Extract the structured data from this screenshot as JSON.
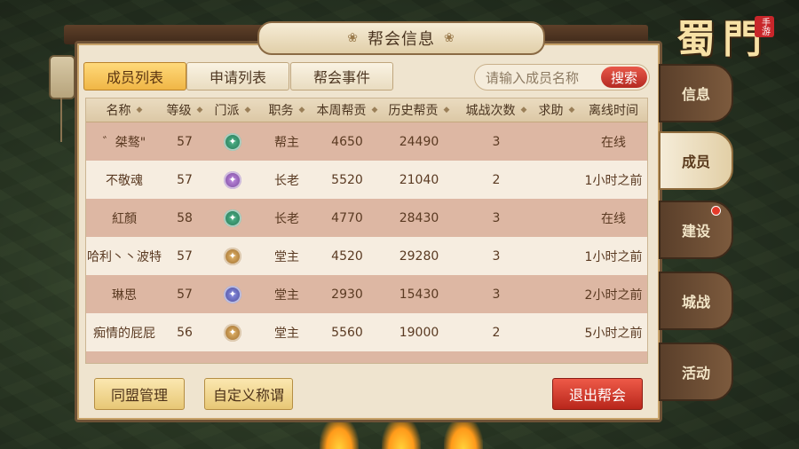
{
  "title": "帮会信息",
  "logo": {
    "text": "蜀門",
    "tag": "手游"
  },
  "tabs": [
    {
      "label": "成员列表",
      "active": true
    },
    {
      "label": "申请列表",
      "active": false
    },
    {
      "label": "帮会事件",
      "active": false
    }
  ],
  "search": {
    "placeholder": "请输入成员名称",
    "button": "搜索"
  },
  "table": {
    "headers": [
      "名称",
      "等级",
      "门派",
      "职务",
      "本周帮贡",
      "历史帮贡",
      "城战次数",
      "求助",
      "离线时间"
    ],
    "rows": [
      {
        "name": "゛桀骜\"",
        "level": "57",
        "sect": "emerald-emblem-icon",
        "role": "帮主",
        "week": "4650",
        "history": "24490",
        "wars": "3",
        "help": "",
        "offline": "在线"
      },
      {
        "name": "不敬魂",
        "level": "57",
        "sect": "violet-emblem-icon",
        "role": "长老",
        "week": "5520",
        "history": "21040",
        "wars": "2",
        "help": "",
        "offline": "1小时之前"
      },
      {
        "name": "紅顏",
        "level": "58",
        "sect": "emerald-emblem-icon",
        "role": "长老",
        "week": "4770",
        "history": "28430",
        "wars": "3",
        "help": "",
        "offline": "在线"
      },
      {
        "name": "哈利丶丶波特",
        "level": "57",
        "sect": "amber-emblem-icon",
        "role": "堂主",
        "week": "4520",
        "history": "29280",
        "wars": "3",
        "help": "",
        "offline": "1小时之前"
      },
      {
        "name": "琳思",
        "level": "57",
        "sect": "indigo-emblem-icon",
        "role": "堂主",
        "week": "2930",
        "history": "15430",
        "wars": "3",
        "help": "",
        "offline": "2小时之前"
      },
      {
        "name": "痴情的屁屁",
        "level": "56",
        "sect": "amber-emblem-icon",
        "role": "堂主",
        "week": "5560",
        "history": "19000",
        "wars": "2",
        "help": "",
        "offline": "5小时之前"
      }
    ]
  },
  "buttons": {
    "alliance": "同盟管理",
    "custom_title": "自定义称谓",
    "leave": "退出帮会"
  },
  "side_tabs": [
    {
      "label": "信息",
      "active": false,
      "badge": false
    },
    {
      "label": "成员",
      "active": true,
      "badge": false
    },
    {
      "label": "建设",
      "active": false,
      "badge": true
    },
    {
      "label": "城战",
      "active": false,
      "badge": false
    },
    {
      "label": "活动",
      "active": false,
      "badge": false
    }
  ]
}
